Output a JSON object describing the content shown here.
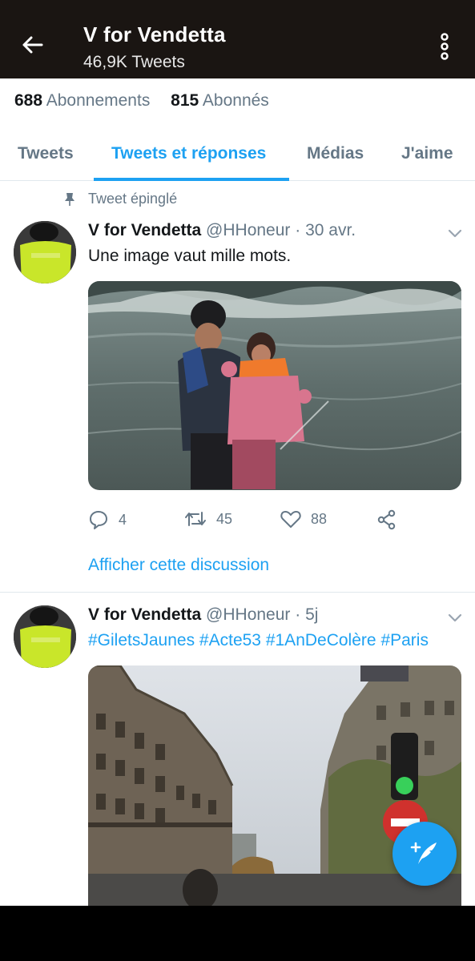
{
  "header": {
    "title": "V for Vendetta",
    "subtitle": "46,9K Tweets",
    "back_icon": "arrow-left-icon",
    "more_icon": "more-vertical-icon"
  },
  "stats": {
    "following_count": "688",
    "following_label": "Abonnements",
    "followers_count": "815",
    "followers_label": "Abonnés"
  },
  "tabs": [
    {
      "label": "Tweets",
      "active": false
    },
    {
      "label": "Tweets et réponses",
      "active": true
    },
    {
      "label": "Médias",
      "active": false
    },
    {
      "label": "J'aime",
      "active": false
    }
  ],
  "colors": {
    "accent": "#1da1f2",
    "header_bg": "#1a1512",
    "secondary_text": "#657786",
    "primary_text": "#14171a"
  },
  "tweets": [
    {
      "pinned_label": "Tweet épinglé",
      "name": "V for Vendetta",
      "handle": "@HHoneur",
      "separator": "·",
      "date": "30 avr.",
      "text": "Une image vaut mille mots.",
      "replies": "4",
      "retweets": "45",
      "likes": "88",
      "thread_link": "Afficher cette discussion"
    },
    {
      "name": "V for Vendetta",
      "handle": "@HHoneur",
      "separator": "·",
      "date": "5j",
      "hashtags": [
        "#GiletsJaunes",
        "#Acte53",
        "#1AnDeColère",
        "#Paris"
      ]
    }
  ],
  "fab": {
    "icon": "compose-tweet-icon"
  }
}
